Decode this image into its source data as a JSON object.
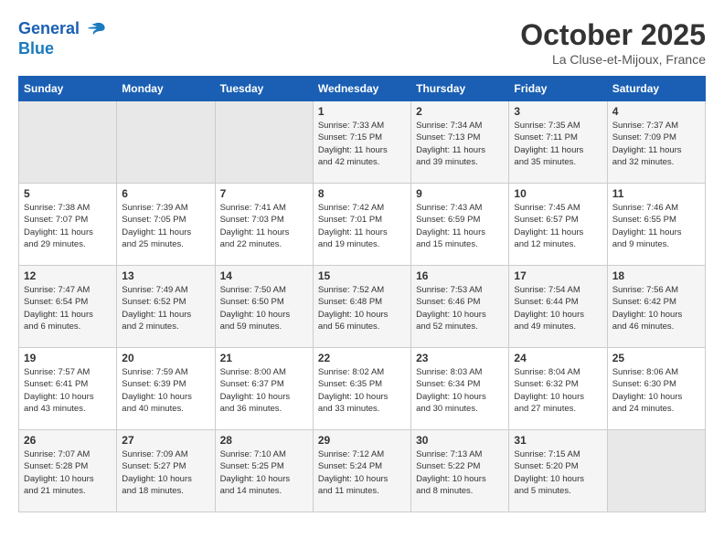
{
  "header": {
    "logo_line1": "General",
    "logo_line2": "Blue",
    "month": "October 2025",
    "location": "La Cluse-et-Mijoux, France"
  },
  "days_of_week": [
    "Sunday",
    "Monday",
    "Tuesday",
    "Wednesday",
    "Thursday",
    "Friday",
    "Saturday"
  ],
  "weeks": [
    [
      {
        "day": "",
        "info": ""
      },
      {
        "day": "",
        "info": ""
      },
      {
        "day": "",
        "info": ""
      },
      {
        "day": "1",
        "info": "Sunrise: 7:33 AM\nSunset: 7:15 PM\nDaylight: 11 hours\nand 42 minutes."
      },
      {
        "day": "2",
        "info": "Sunrise: 7:34 AM\nSunset: 7:13 PM\nDaylight: 11 hours\nand 39 minutes."
      },
      {
        "day": "3",
        "info": "Sunrise: 7:35 AM\nSunset: 7:11 PM\nDaylight: 11 hours\nand 35 minutes."
      },
      {
        "day": "4",
        "info": "Sunrise: 7:37 AM\nSunset: 7:09 PM\nDaylight: 11 hours\nand 32 minutes."
      }
    ],
    [
      {
        "day": "5",
        "info": "Sunrise: 7:38 AM\nSunset: 7:07 PM\nDaylight: 11 hours\nand 29 minutes."
      },
      {
        "day": "6",
        "info": "Sunrise: 7:39 AM\nSunset: 7:05 PM\nDaylight: 11 hours\nand 25 minutes."
      },
      {
        "day": "7",
        "info": "Sunrise: 7:41 AM\nSunset: 7:03 PM\nDaylight: 11 hours\nand 22 minutes."
      },
      {
        "day": "8",
        "info": "Sunrise: 7:42 AM\nSunset: 7:01 PM\nDaylight: 11 hours\nand 19 minutes."
      },
      {
        "day": "9",
        "info": "Sunrise: 7:43 AM\nSunset: 6:59 PM\nDaylight: 11 hours\nand 15 minutes."
      },
      {
        "day": "10",
        "info": "Sunrise: 7:45 AM\nSunset: 6:57 PM\nDaylight: 11 hours\nand 12 minutes."
      },
      {
        "day": "11",
        "info": "Sunrise: 7:46 AM\nSunset: 6:55 PM\nDaylight: 11 hours\nand 9 minutes."
      }
    ],
    [
      {
        "day": "12",
        "info": "Sunrise: 7:47 AM\nSunset: 6:54 PM\nDaylight: 11 hours\nand 6 minutes."
      },
      {
        "day": "13",
        "info": "Sunrise: 7:49 AM\nSunset: 6:52 PM\nDaylight: 11 hours\nand 2 minutes."
      },
      {
        "day": "14",
        "info": "Sunrise: 7:50 AM\nSunset: 6:50 PM\nDaylight: 10 hours\nand 59 minutes."
      },
      {
        "day": "15",
        "info": "Sunrise: 7:52 AM\nSunset: 6:48 PM\nDaylight: 10 hours\nand 56 minutes."
      },
      {
        "day": "16",
        "info": "Sunrise: 7:53 AM\nSunset: 6:46 PM\nDaylight: 10 hours\nand 52 minutes."
      },
      {
        "day": "17",
        "info": "Sunrise: 7:54 AM\nSunset: 6:44 PM\nDaylight: 10 hours\nand 49 minutes."
      },
      {
        "day": "18",
        "info": "Sunrise: 7:56 AM\nSunset: 6:42 PM\nDaylight: 10 hours\nand 46 minutes."
      }
    ],
    [
      {
        "day": "19",
        "info": "Sunrise: 7:57 AM\nSunset: 6:41 PM\nDaylight: 10 hours\nand 43 minutes."
      },
      {
        "day": "20",
        "info": "Sunrise: 7:59 AM\nSunset: 6:39 PM\nDaylight: 10 hours\nand 40 minutes."
      },
      {
        "day": "21",
        "info": "Sunrise: 8:00 AM\nSunset: 6:37 PM\nDaylight: 10 hours\nand 36 minutes."
      },
      {
        "day": "22",
        "info": "Sunrise: 8:02 AM\nSunset: 6:35 PM\nDaylight: 10 hours\nand 33 minutes."
      },
      {
        "day": "23",
        "info": "Sunrise: 8:03 AM\nSunset: 6:34 PM\nDaylight: 10 hours\nand 30 minutes."
      },
      {
        "day": "24",
        "info": "Sunrise: 8:04 AM\nSunset: 6:32 PM\nDaylight: 10 hours\nand 27 minutes."
      },
      {
        "day": "25",
        "info": "Sunrise: 8:06 AM\nSunset: 6:30 PM\nDaylight: 10 hours\nand 24 minutes."
      }
    ],
    [
      {
        "day": "26",
        "info": "Sunrise: 7:07 AM\nSunset: 5:28 PM\nDaylight: 10 hours\nand 21 minutes."
      },
      {
        "day": "27",
        "info": "Sunrise: 7:09 AM\nSunset: 5:27 PM\nDaylight: 10 hours\nand 18 minutes."
      },
      {
        "day": "28",
        "info": "Sunrise: 7:10 AM\nSunset: 5:25 PM\nDaylight: 10 hours\nand 14 minutes."
      },
      {
        "day": "29",
        "info": "Sunrise: 7:12 AM\nSunset: 5:24 PM\nDaylight: 10 hours\nand 11 minutes."
      },
      {
        "day": "30",
        "info": "Sunrise: 7:13 AM\nSunset: 5:22 PM\nDaylight: 10 hours\nand 8 minutes."
      },
      {
        "day": "31",
        "info": "Sunrise: 7:15 AM\nSunset: 5:20 PM\nDaylight: 10 hours\nand 5 minutes."
      },
      {
        "day": "",
        "info": ""
      }
    ]
  ]
}
